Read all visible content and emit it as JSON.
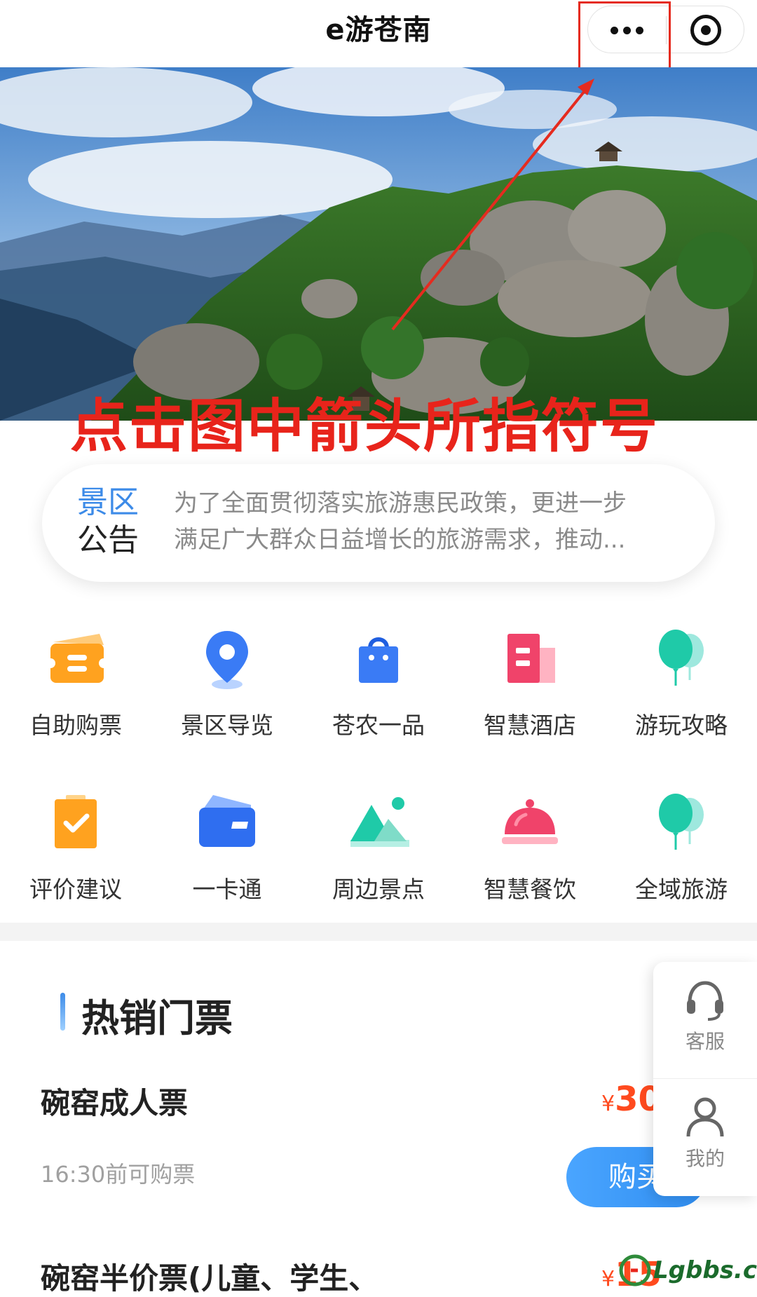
{
  "app": {
    "title": "e游苍南"
  },
  "banner": {
    "instruction": "点击图中箭头所指符号"
  },
  "notice": {
    "tag_line1": "景区",
    "tag_line2": "公告",
    "text_line1": "为了全面贯彻落实旅游惠民政策，更进一步",
    "text_line2": "满足广大群众日益增长的旅游需求，推动..."
  },
  "grid": {
    "row1": [
      {
        "label": "自助购票",
        "icon": "ticket-icon"
      },
      {
        "label": "景区导览",
        "icon": "map-pin-icon"
      },
      {
        "label": "苍农一品",
        "icon": "shopping-bag-icon"
      },
      {
        "label": "智慧酒店",
        "icon": "hotel-icon"
      },
      {
        "label": "游玩攻略",
        "icon": "balloon-icon"
      }
    ],
    "row2": [
      {
        "label": "评价建议",
        "icon": "clipboard-check-icon"
      },
      {
        "label": "一卡通",
        "icon": "wallet-card-icon"
      },
      {
        "label": "周边景点",
        "icon": "mountain-icon"
      },
      {
        "label": "智慧餐饮",
        "icon": "dish-cover-icon"
      },
      {
        "label": "全域旅游",
        "icon": "balloon-icon"
      }
    ]
  },
  "hot": {
    "title": "热销门票",
    "tickets": [
      {
        "name": "碗窑成人票",
        "time": "16:30前可购票",
        "currency": "¥",
        "price": "30",
        "buy": "购买"
      },
      {
        "name": "碗窑半价票(儿童、学生、",
        "currency": "¥",
        "price": "15"
      }
    ]
  },
  "float_panel": {
    "service": "客服",
    "mine": "我的"
  },
  "watermark": {
    "text": "Lgbbs.cn"
  },
  "colors": {
    "accent": "#3d8be8",
    "price": "#ff4a1e",
    "annotation": "#e8241b"
  }
}
